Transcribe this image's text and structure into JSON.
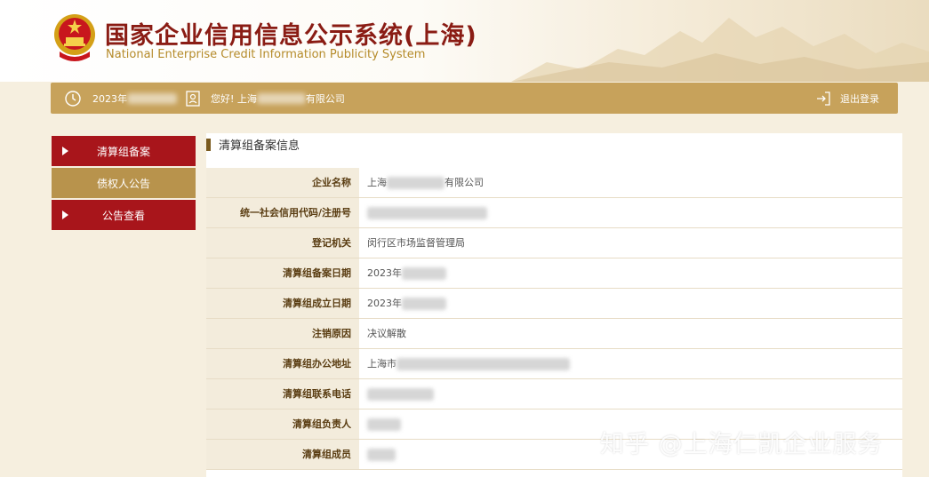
{
  "header": {
    "title_cn": "国家企业信用信息公示系统(上海)",
    "title_en": "National Enterprise Credit Information Publicity System"
  },
  "userbar": {
    "date_prefix": "2023年",
    "greeting": "您好! 上海",
    "company_suffix": "有限公司",
    "logout_label": "退出登录"
  },
  "sidebar": {
    "items": [
      {
        "label": "清算组备案",
        "style": "red",
        "has_arrow": true
      },
      {
        "label": "债权人公告",
        "style": "gold",
        "has_arrow": false
      },
      {
        "label": "公告查看",
        "style": "red",
        "has_arrow": true
      }
    ]
  },
  "main": {
    "section_title": "清算组备案信息",
    "rows": [
      {
        "label": "企业名称",
        "prefix": "上海",
        "suffix": "有限公司"
      },
      {
        "label": "统一社会信用代码/注册号",
        "prefix": "",
        "suffix": ""
      },
      {
        "label": "登记机关",
        "prefix": "闵行区市场监督管理局",
        "suffix": ""
      },
      {
        "label": "清算组备案日期",
        "prefix": "2023年",
        "suffix": ""
      },
      {
        "label": "清算组成立日期",
        "prefix": "2023年",
        "suffix": ""
      },
      {
        "label": "注销原因",
        "prefix": "决议解散",
        "suffix": ""
      },
      {
        "label": "清算组办公地址",
        "prefix": "上海市",
        "suffix": ""
      },
      {
        "label": "清算组联系电话",
        "prefix": "",
        "suffix": ""
      },
      {
        "label": "清算组负责人",
        "prefix": "",
        "suffix": ""
      },
      {
        "label": "清算组成员",
        "prefix": "",
        "suffix": ""
      }
    ]
  },
  "watermark": "知乎 @上海仁凯企业服务",
  "colors": {
    "brand_red": "#a8151b",
    "gold": "#c7a25b",
    "title_red": "#8a1c14"
  }
}
